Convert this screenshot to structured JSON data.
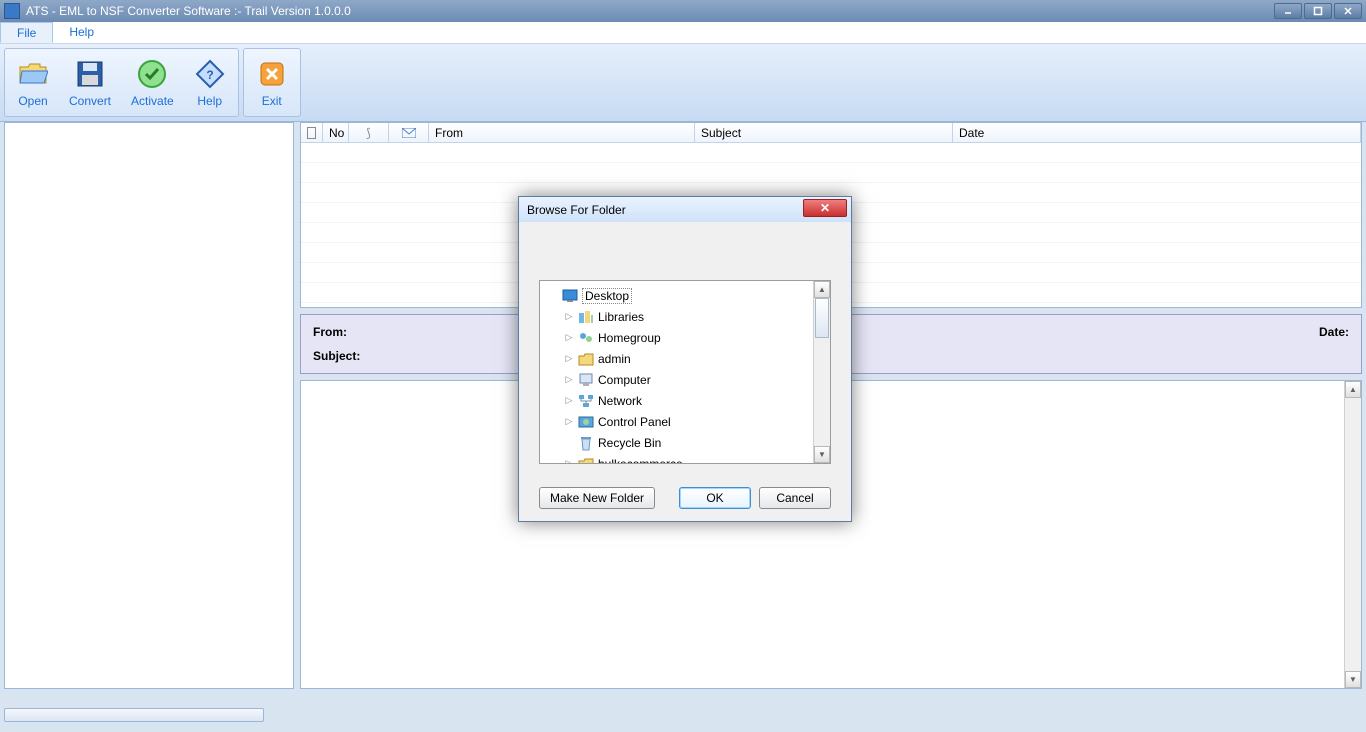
{
  "titlebar": {
    "title": "ATS - EML to NSF Converter Software :- Trail Version 1.0.0.0"
  },
  "menubar": {
    "file": "File",
    "help": "Help"
  },
  "ribbon": {
    "open": "Open",
    "convert": "Convert",
    "activate": "Activate",
    "help": "Help",
    "exit": "Exit"
  },
  "grid": {
    "cols": {
      "no": "No",
      "from": "From",
      "subject": "Subject",
      "date": "Date"
    }
  },
  "info": {
    "from": "From:",
    "date": "Date:",
    "subject": "Subject:"
  },
  "dialog": {
    "title": "Browse For Folder",
    "tree": {
      "desktop": "Desktop",
      "libraries": "Libraries",
      "homegroup": "Homegroup",
      "admin": "admin",
      "computer": "Computer",
      "network": "Network",
      "controlpanel": "Control Panel",
      "recyclebin": "Recycle Bin",
      "bulk": "bulkecommerce"
    },
    "makenew": "Make New Folder",
    "ok": "OK",
    "cancel": "Cancel"
  }
}
